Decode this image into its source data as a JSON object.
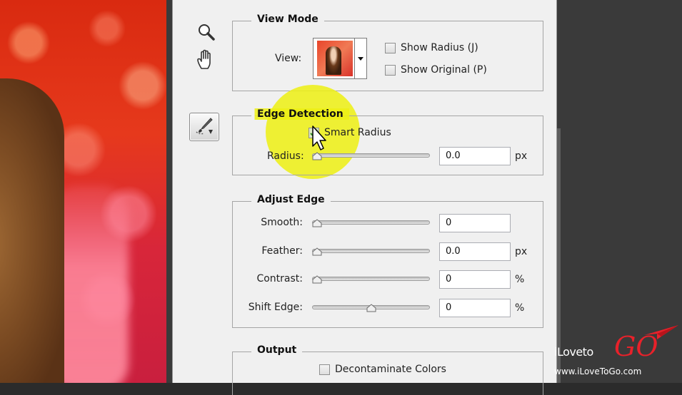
{
  "view_mode": {
    "title": "View Mode",
    "view_label": "View:",
    "show_radius_label": "Show Radius (J)",
    "show_original_label": "Show Original (P)"
  },
  "edge_detection": {
    "title": "Edge Detection",
    "smart_radius_label": "Smart Radius",
    "smart_radius_checked": true,
    "radius_label": "Radius:",
    "radius_value": "0.0",
    "radius_unit": "px"
  },
  "adjust_edge": {
    "title": "Adjust Edge",
    "rows": [
      {
        "label": "Smooth:",
        "value": "0",
        "unit": "",
        "level": 0
      },
      {
        "label": "Feather:",
        "value": "0.0",
        "unit": "px",
        "level": 0
      },
      {
        "label": "Contrast:",
        "value": "0",
        "unit": "%",
        "level": 0
      },
      {
        "label": "Shift Edge:",
        "value": "0",
        "unit": "%",
        "level": 0.5
      }
    ]
  },
  "output": {
    "title": "Output",
    "decontaminate_label": "Decontaminate Colors"
  },
  "watermark": {
    "brand_prefix": "iLoveto",
    "brand_go": "GO",
    "url": "www.iLoveToGo.com"
  },
  "icons": [
    "zoom-icon",
    "hand-icon",
    "refine-radius-brush-icon",
    "view-dropdown-arrow-icon",
    "cursor-arrow-icon",
    "paper-plane-icon"
  ],
  "colors": {
    "highlight": "#eef014",
    "dialog_bg": "#f0f0f0",
    "logo_red": "#e8212a"
  }
}
